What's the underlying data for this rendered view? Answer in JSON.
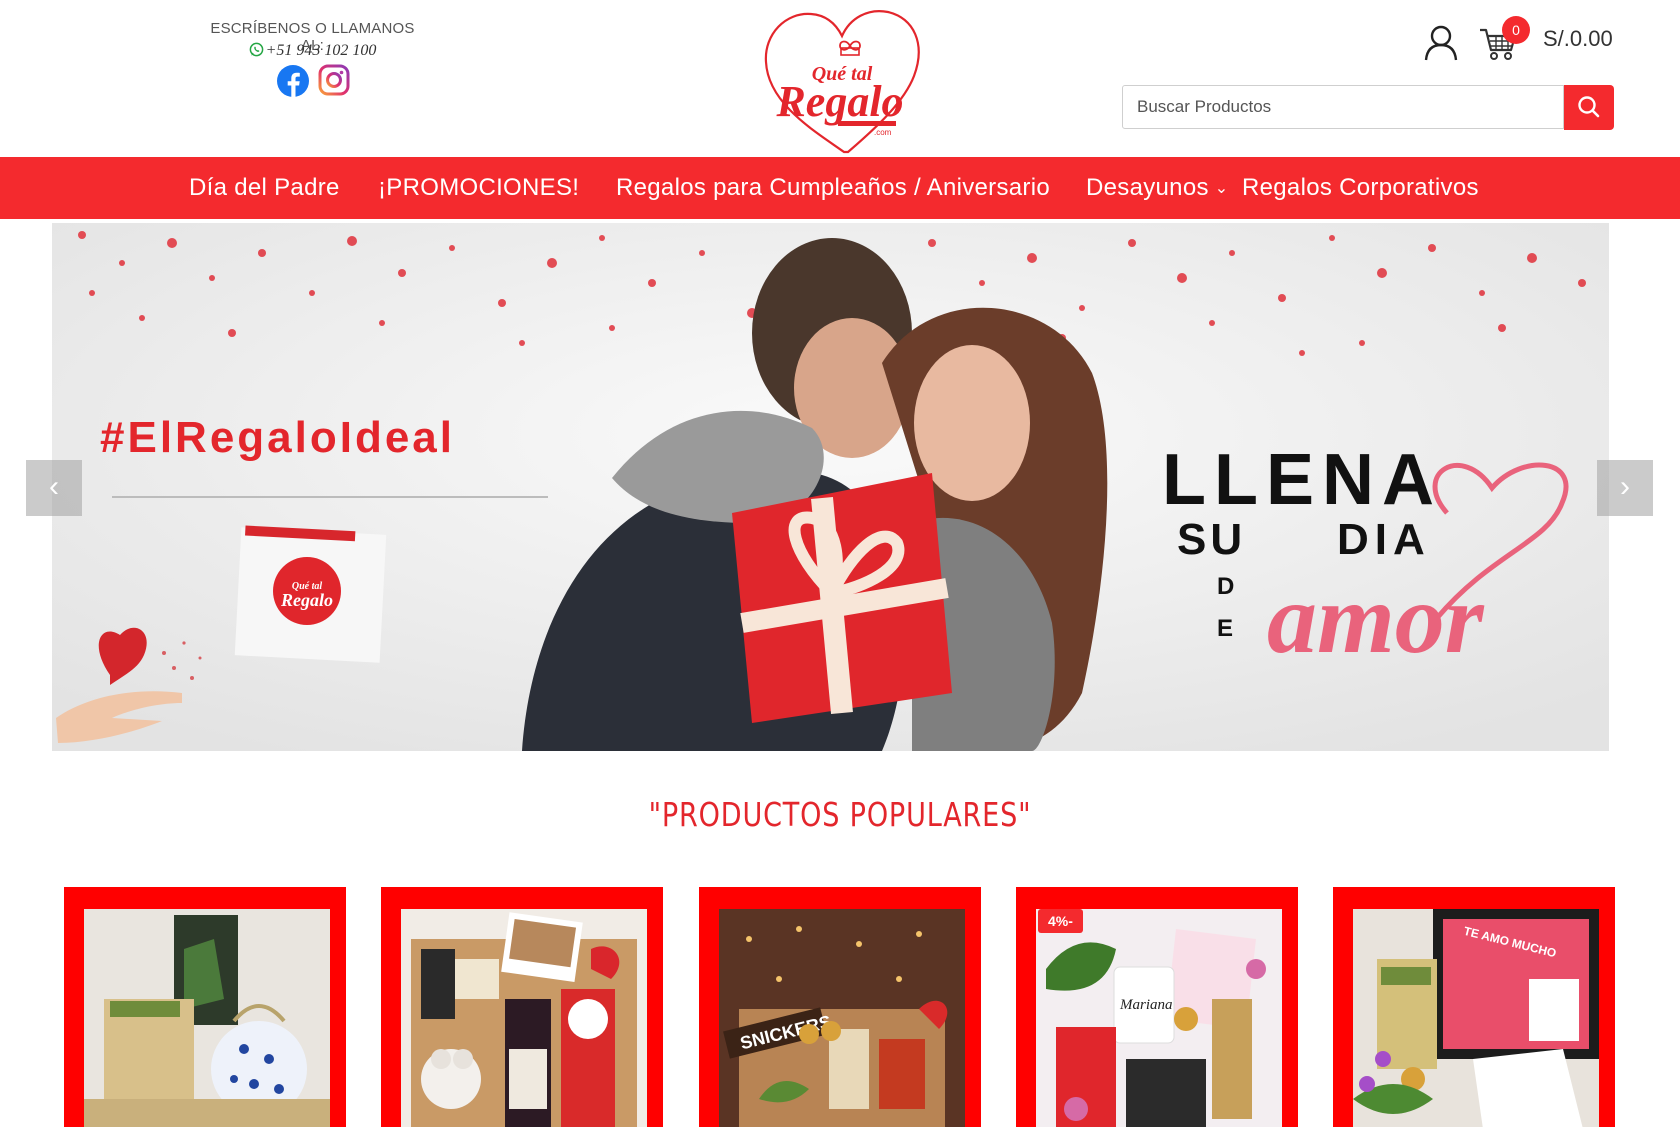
{
  "header": {
    "contact_label": "ESCRÍBENOS O LLAMANOS AL:",
    "phone": "+51 943 102 100",
    "social": [
      "facebook-icon",
      "instagram-icon"
    ],
    "logo_text": "Qué tal Regalo",
    "logo_suffix": ".com",
    "cart_count": "0",
    "cart_total": "S/.0.00",
    "search_placeholder": "Buscar Productos"
  },
  "nav": {
    "items": [
      {
        "label": "Día del Padre"
      },
      {
        "label": "¡PROMOCIONES!"
      },
      {
        "label": "Regalos para Cumpleaños / Aniversario"
      },
      {
        "label": "Desayunos"
      },
      {
        "label": "Regalos Corporativos"
      }
    ]
  },
  "hero": {
    "hashtag": "#ElRegaloIdeal",
    "headline_1": "LLENA",
    "headline_2a": "SU",
    "headline_2b": "DIA",
    "headline_3a": "D",
    "headline_3b": "E",
    "headline_script": "amor",
    "card_logo": "Qué tal Regalo"
  },
  "section": {
    "title": "\"PRODUCTOS POPULARES\""
  },
  "products": [
    {
      "badge": ""
    },
    {
      "badge": ""
    },
    {
      "badge": ""
    },
    {
      "badge": "4%-"
    },
    {
      "badge": ""
    }
  ],
  "colors": {
    "brand_red": "#f42a2e",
    "title_red": "#e3262c",
    "amor_pink": "#e9637c"
  }
}
